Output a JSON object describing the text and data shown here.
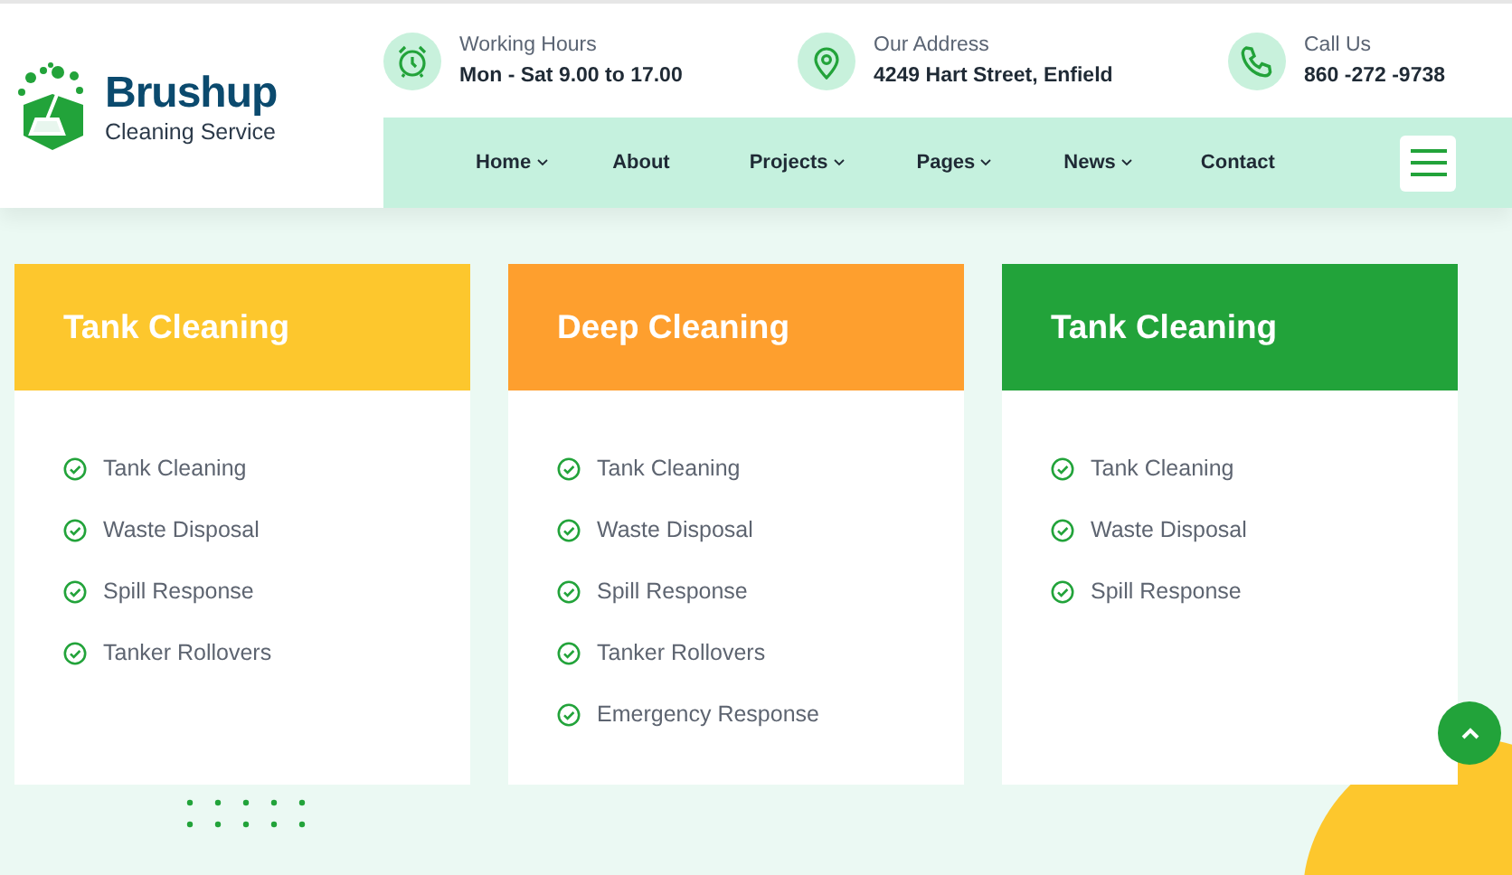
{
  "brand": {
    "name": "Brushup",
    "tagline": "Cleaning Service"
  },
  "contacts": [
    {
      "kind": "clock",
      "label": "Working Hours",
      "value": "Mon - Sat 9.00 to 17.00"
    },
    {
      "kind": "pin",
      "label": "Our Address",
      "value": "4249 Hart Street, Enfield"
    },
    {
      "kind": "phone",
      "label": "Call Us",
      "value": "860 -272 -9738"
    }
  ],
  "nav": {
    "items": [
      {
        "label": "Home",
        "dropdown": true
      },
      {
        "label": "About",
        "dropdown": false
      },
      {
        "label": "Projects",
        "dropdown": true
      },
      {
        "label": "Pages",
        "dropdown": true
      },
      {
        "label": "News",
        "dropdown": true
      },
      {
        "label": "Contact",
        "dropdown": false
      }
    ]
  },
  "cards": [
    {
      "title": "Tank Cleaning",
      "color": "#fdc72d",
      "features": [
        "Tank Cleaning",
        "Waste Disposal",
        "Spill Response",
        "Tanker Rollovers"
      ]
    },
    {
      "title": "Deep Cleaning",
      "color": "#fe9f2e",
      "features": [
        "Tank Cleaning",
        "Waste Disposal",
        "Spill Response",
        "Tanker Rollovers",
        "Emergency Response"
      ]
    },
    {
      "title": "Tank Cleaning",
      "color": "#22a33a",
      "features": [
        "Tank Cleaning",
        "Waste Disposal",
        "Spill Response"
      ]
    }
  ]
}
